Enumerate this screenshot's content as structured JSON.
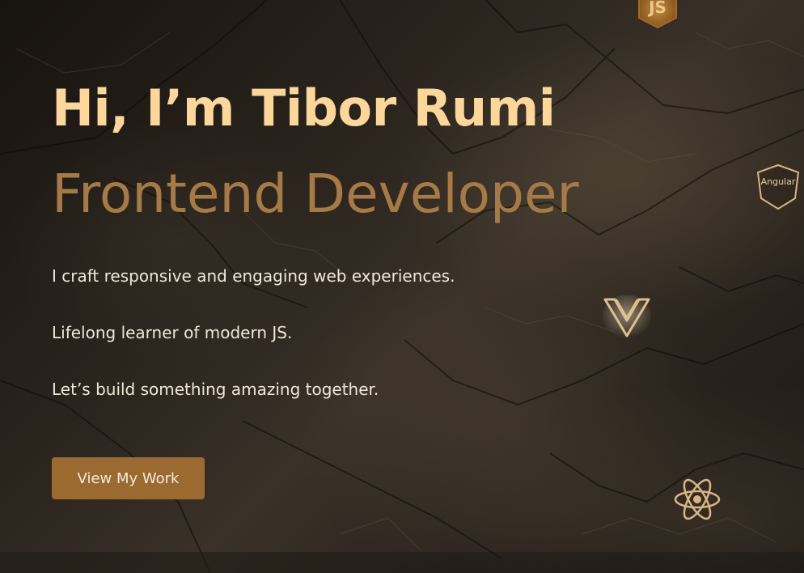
{
  "hero": {
    "greeting": "Hi, I’m Tibor Rumi",
    "role": "Frontend Developer",
    "taglines": [
      "I craft responsive and engaging web experiences.",
      "Lifelong learner of modern JS.",
      "Let’s build something amazing together."
    ],
    "cta_label": "View My Work"
  },
  "tech_icons": {
    "js": {
      "label": "JS",
      "icon": "javascript-icon"
    },
    "angular": {
      "label": "Angular",
      "icon": "angular-icon"
    },
    "vue": {
      "icon": "vue-icon"
    },
    "react": {
      "icon": "react-icon"
    }
  },
  "colors": {
    "greeting": "#fbd79b",
    "role": "#a57a47",
    "body_text": "#f1e7d8",
    "button_bg": "#9a6a31",
    "icon_gold": "#d8b583"
  }
}
